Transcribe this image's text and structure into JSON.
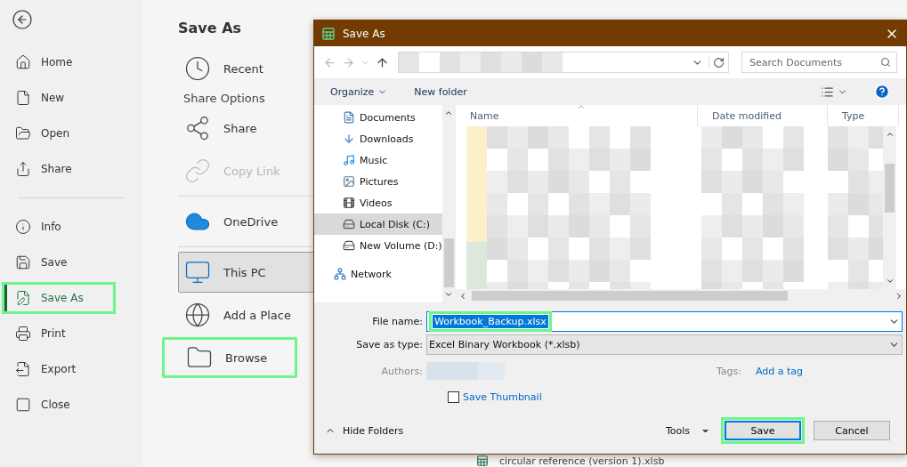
{
  "backstage": {
    "nav_top": [
      {
        "label": "Home",
        "selected": false,
        "highlighted": false
      },
      {
        "label": "New",
        "selected": false,
        "highlighted": false
      },
      {
        "label": "Open",
        "selected": false,
        "highlighted": false
      },
      {
        "label": "Share",
        "selected": false,
        "highlighted": false
      }
    ],
    "nav_bottom": [
      {
        "label": "Info",
        "selected": false,
        "highlighted": false
      },
      {
        "label": "Save",
        "selected": false,
        "highlighted": false
      },
      {
        "label": "Save As",
        "selected": true,
        "highlighted": true
      },
      {
        "label": "Print",
        "selected": false,
        "highlighted": false
      },
      {
        "label": "Export",
        "selected": false,
        "highlighted": false
      },
      {
        "label": "Close",
        "selected": false,
        "highlighted": false
      }
    ],
    "title": "Save As",
    "locations": [
      {
        "kind": "place",
        "label": "Recent",
        "disabled": false,
        "selected": false,
        "highlighted": false
      },
      {
        "kind": "heading",
        "label": "Share Options"
      },
      {
        "kind": "place",
        "label": "Share",
        "disabled": false,
        "selected": false,
        "highlighted": false
      },
      {
        "kind": "place",
        "label": "Copy Link",
        "disabled": true,
        "selected": false,
        "highlighted": false
      },
      {
        "kind": "divider"
      },
      {
        "kind": "place",
        "label": "OneDrive",
        "disabled": false,
        "selected": false,
        "highlighted": false
      },
      {
        "kind": "divider"
      },
      {
        "kind": "place",
        "label": "This PC",
        "disabled": false,
        "selected": true,
        "highlighted": false
      },
      {
        "kind": "place",
        "label": "Add a Place",
        "disabled": false,
        "selected": false,
        "highlighted": false
      },
      {
        "kind": "place",
        "label": "Browse",
        "disabled": false,
        "selected": false,
        "highlighted": true
      }
    ],
    "recent_file": "circular reference (version 1).xlsb"
  },
  "dialog": {
    "title": "Save As",
    "search": {
      "placeholder": "Search Documents"
    },
    "toolbar": {
      "organize": "Organize",
      "new_folder": "New folder"
    },
    "tree": [
      {
        "kind": "child",
        "label": "Documents",
        "selected": false
      },
      {
        "kind": "child",
        "label": "Downloads",
        "selected": false
      },
      {
        "kind": "child",
        "label": "Music",
        "selected": false
      },
      {
        "kind": "child",
        "label": "Pictures",
        "selected": false
      },
      {
        "kind": "child",
        "label": "Videos",
        "selected": false
      },
      {
        "kind": "child",
        "label": "Local Disk (C:)",
        "selected": true
      },
      {
        "kind": "child",
        "label": "New Volume (D:)",
        "selected": false
      },
      {
        "kind": "root",
        "label": "Network",
        "selected": false
      }
    ],
    "columns": [
      {
        "label": "Name",
        "sorted": true
      },
      {
        "label": "Date modified",
        "sorted": false
      },
      {
        "label": "Type",
        "sorted": false
      }
    ],
    "file_name": {
      "label": "File name:",
      "value": "Workbook_Backup.xlsx",
      "highlighted": true
    },
    "save_as_type": {
      "label": "Save as type:",
      "value": "Excel Binary Workbook (*.xlsb)"
    },
    "authors": {
      "label": "Authors:"
    },
    "tags": {
      "label": "Tags:",
      "link": "Add a tag"
    },
    "save_thumbnail": {
      "label": "Save Thumbnail",
      "checked": false
    },
    "hide_folders": "Hide Folders",
    "tools": "Tools",
    "buttons": [
      {
        "label": "Save",
        "default": true,
        "highlighted": true
      },
      {
        "label": "Cancel",
        "default": false,
        "highlighted": false
      }
    ]
  }
}
